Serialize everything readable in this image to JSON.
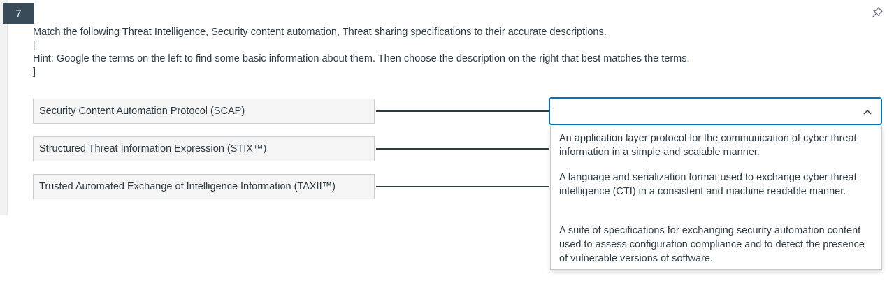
{
  "question": {
    "number": "7",
    "prompt": "Match the following Threat Intelligence, Security content automation, Threat sharing specifications to their accurate descriptions.",
    "bracket_open": "[",
    "hint": "Hint: Google the terms on the left to find some basic information about them. Then choose the description on the right that best matches the terms.",
    "bracket_close": "]"
  },
  "terms": [
    "Security Content Automation Protocol (SCAP)",
    "Structured Threat Information Expression (STIX™)",
    "Trusted Automated Exchange of Intelligence Information (TAXII™)"
  ],
  "select": {
    "value": "",
    "expanded": true
  },
  "options": [
    "An application layer protocol for the communication of cyber threat information in a simple and scalable manner.",
    "A language and serialization format used to exchange cyber threat intelligence (CTI) in a consistent and machine readable manner.",
    "A suite of specifications for exchanging security automation content used to assess configuration compliance and to detect the presence of vulnerable versions of software."
  ],
  "icons": {
    "pin": "pin-icon",
    "chevron": "chevron-up-icon"
  },
  "colors": {
    "question_badge": "#394b58",
    "focus_border": "#0374b5",
    "text": "#2d3b45"
  }
}
